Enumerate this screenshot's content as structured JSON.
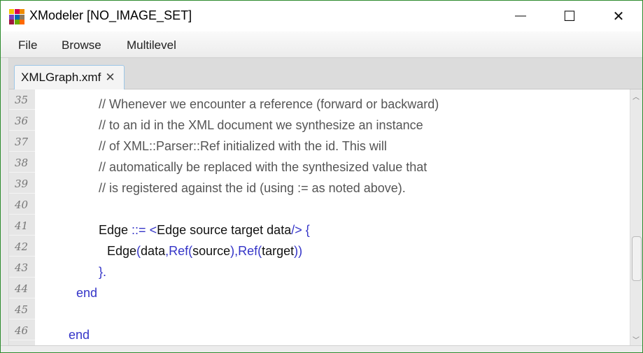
{
  "window": {
    "title": "XModeler  [NO_IMAGE_SET]",
    "logo_colors": [
      "#f5c400",
      "#d6004f",
      "#f08a00",
      "#7a3fbf",
      "#0066b3",
      "#8c7a60",
      "#a0153e",
      "#6aaa00",
      "#ff6a00"
    ],
    "minimize": "—",
    "maximize": "☐",
    "close": "✕"
  },
  "menu": [
    "File",
    "Browse",
    "Multilevel"
  ],
  "tab": {
    "label": "XMLGraph.xmf",
    "close": "✕"
  },
  "editor": {
    "lines": [
      {
        "n": "35",
        "segs": [
          {
            "t": "// Whenever we encounter a reference (forward or backward)",
            "k": "comment"
          }
        ]
      },
      {
        "n": "36",
        "segs": [
          {
            "t": "// to an id in the XML document we synthesize an instance",
            "k": "comment"
          }
        ]
      },
      {
        "n": "37",
        "segs": [
          {
            "t": "// of XML::Parser::Ref initialized with the id. This will",
            "k": "comment"
          }
        ]
      },
      {
        "n": "38",
        "segs": [
          {
            "t": "// automatically be replaced with the synthesized value that",
            "k": "comment"
          }
        ]
      },
      {
        "n": "39",
        "segs": [
          {
            "t": "// is registered against the id (using := as noted above).",
            "k": "comment"
          }
        ]
      },
      {
        "n": "40",
        "segs": []
      },
      {
        "n": "41",
        "segs": [
          {
            "t": "Edge ",
            "k": "plain"
          },
          {
            "t": "::= ",
            "k": "kw"
          },
          {
            "t": "<",
            "k": "kw"
          },
          {
            "t": "Edge source target data",
            "k": "plain"
          },
          {
            "t": "/> {",
            "k": "kw"
          }
        ]
      },
      {
        "n": "42",
        "segs": [
          {
            "t": "Edge",
            "k": "plain"
          },
          {
            "t": "(",
            "k": "kw"
          },
          {
            "t": "data",
            "k": "plain"
          },
          {
            "t": ",Ref(",
            "k": "kw"
          },
          {
            "t": "source",
            "k": "plain"
          },
          {
            "t": "),Ref(",
            "k": "kw"
          },
          {
            "t": "target",
            "k": "plain"
          },
          {
            "t": "))",
            "k": "kw"
          }
        ]
      },
      {
        "n": "43",
        "segs": [
          {
            "t": "}.",
            "k": "kw"
          }
        ]
      },
      {
        "n": "44",
        "segs": [
          {
            "t": "end",
            "k": "kw"
          }
        ]
      },
      {
        "n": "45",
        "segs": []
      },
      {
        "n": "46",
        "segs": [
          {
            "t": "end",
            "k": "kw"
          }
        ]
      }
    ]
  }
}
